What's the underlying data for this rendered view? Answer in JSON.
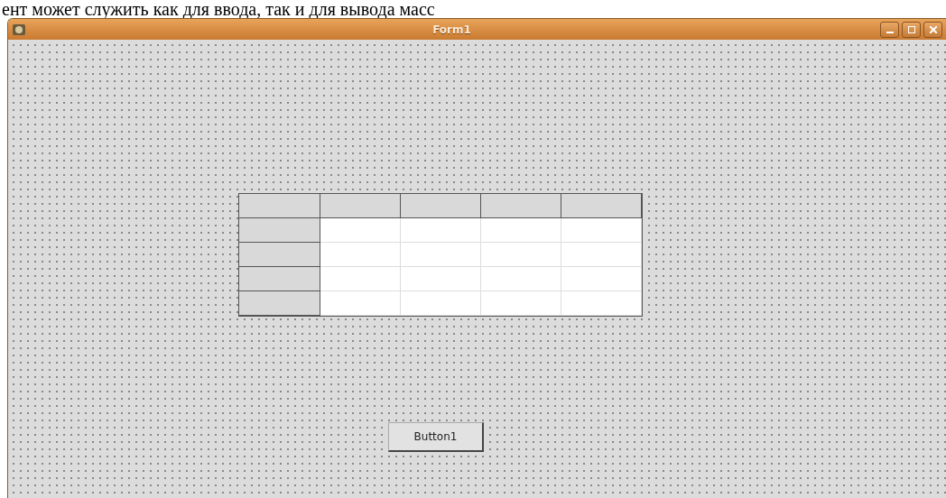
{
  "document_text": "ент может служить как для ввода, так и для вывода масс",
  "window": {
    "title": "Form1"
  },
  "string_grid": {
    "rows": [
      {
        "cells": [
          {
            "kind": "fixed"
          },
          {
            "kind": "fixed"
          },
          {
            "kind": "fixed"
          },
          {
            "kind": "fixed"
          },
          {
            "kind": "fixed"
          }
        ]
      },
      {
        "cells": [
          {
            "kind": "fixed"
          },
          {
            "kind": "cell"
          },
          {
            "kind": "cell"
          },
          {
            "kind": "cell"
          },
          {
            "kind": "cell"
          }
        ]
      },
      {
        "cells": [
          {
            "kind": "fixed"
          },
          {
            "kind": "cell"
          },
          {
            "kind": "cell"
          },
          {
            "kind": "cell"
          },
          {
            "kind": "cell"
          }
        ]
      },
      {
        "cells": [
          {
            "kind": "fixed"
          },
          {
            "kind": "cell"
          },
          {
            "kind": "cell"
          },
          {
            "kind": "cell"
          },
          {
            "kind": "cell"
          }
        ]
      },
      {
        "cells": [
          {
            "kind": "fixed"
          },
          {
            "kind": "cell"
          },
          {
            "kind": "cell"
          },
          {
            "kind": "cell"
          },
          {
            "kind": "cell"
          }
        ]
      }
    ]
  },
  "button": {
    "label": "Button1"
  }
}
